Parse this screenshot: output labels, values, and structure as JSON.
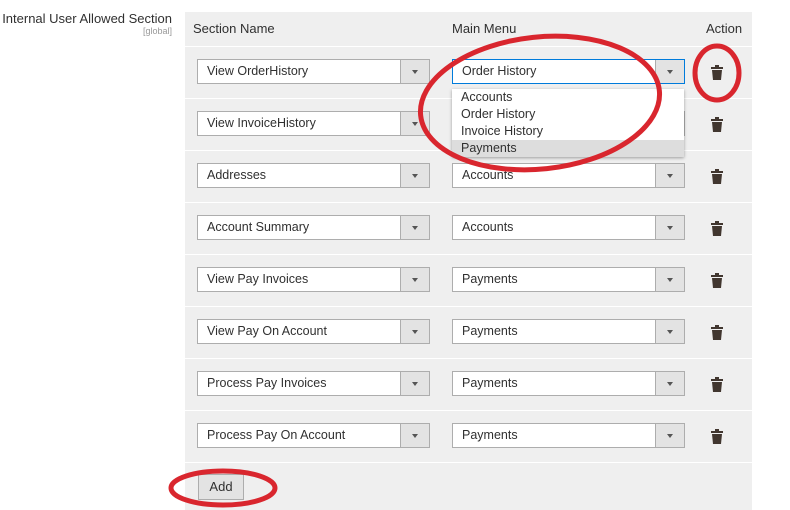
{
  "field": {
    "label": "Internal User Allowed Section",
    "scope": "[global]"
  },
  "table": {
    "headers": {
      "section": "Section Name",
      "menu": "Main Menu",
      "action": "Action"
    },
    "rows": [
      {
        "section": "View OrderHistory",
        "menu": "Order History"
      },
      {
        "section": "View InvoiceHistory",
        "menu": ""
      },
      {
        "section": "Addresses",
        "menu": "Accounts"
      },
      {
        "section": "Account Summary",
        "menu": "Accounts"
      },
      {
        "section": "View Pay Invoices",
        "menu": "Payments"
      },
      {
        "section": "View Pay On Account",
        "menu": "Payments"
      },
      {
        "section": "Process Pay Invoices",
        "menu": "Payments"
      },
      {
        "section": "Process Pay On Account",
        "menu": "Payments"
      }
    ]
  },
  "dropdown": {
    "options": [
      "Accounts",
      "Order History",
      "Invoice History",
      "Payments"
    ],
    "highlighted": "Payments"
  },
  "add_label": "Add",
  "colors": {
    "annotation": "#d9262e",
    "focus": "#007bdb"
  }
}
